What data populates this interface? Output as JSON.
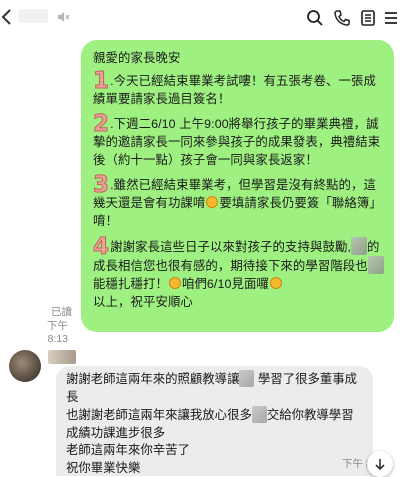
{
  "header": {
    "back_icon": "chevron-left-icon",
    "icons": [
      "mute-icon",
      "search-icon",
      "phone-icon",
      "notes-icon",
      "menu-icon"
    ]
  },
  "outgoing": {
    "greeting": "親愛的家長晚安",
    "paragraphs": [
      {
        "num": "1",
        "text": ".今天已經結束畢業考試嘍！有五張考卷、一張成績單要請家長過目簽名！"
      },
      {
        "num": "2",
        "text": ".下週二6/10 上午9:00將舉行孩子的畢業典禮，誠摯的邀請家長一同來參與孩子的成果發表，典禮結束後（約十一點）孩子會一同與家長返家！"
      },
      {
        "num": "3",
        "text_a": ".雖然已經結束畢業考，但學習是沒有終點的，這幾天還是會有功課唷",
        "text_b": "要填請家長仍要簽「聯絡簿」唷！"
      },
      {
        "num": "4",
        "text_a": "謝謝家長這些日子以來對孩子的支持與鼓勵,",
        "text_b": "的成長相信您也很有感的，期待接下來的學習階段也",
        "text_c": "能穩扎穩打！",
        "text_d": "咱們6/10見面囉",
        "text_e": "以上，祝平安順心"
      }
    ],
    "read_label": "已讀",
    "time": "下午 8:13"
  },
  "incoming": {
    "lines": [
      "謝謝老師這兩年來的照顧教導讓",
      "學習了很多董事成長",
      "也謝謝老師這兩年來讓我放心很多",
      "交給你教導學習成績功課進步很多",
      "老師這兩年來你辛苦了",
      "祝你畢業快樂"
    ],
    "time": "下午 8"
  },
  "colors": {
    "outgoing_bubble": "#9ef081",
    "incoming_bubble": "#ececec",
    "number_fill": "#e9a29a"
  }
}
